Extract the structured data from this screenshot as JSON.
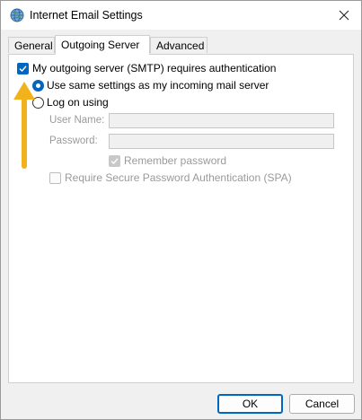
{
  "window": {
    "title": "Internet Email Settings"
  },
  "icons": {
    "app": "globe-icon",
    "close": "close-icon",
    "annotation_arrow": "arrow-up-icon"
  },
  "colors": {
    "accent": "#0067c0",
    "arrow": "#f2b21b"
  },
  "tabs": [
    {
      "label": "General",
      "active": false
    },
    {
      "label": "Outgoing Server",
      "active": true
    },
    {
      "label": "Advanced",
      "active": false
    }
  ],
  "outgoing": {
    "requires_auth_label": "My outgoing server (SMTP) requires authentication",
    "requires_auth_checked": true,
    "use_same_label": "Use same settings as my incoming mail server",
    "use_same_selected": true,
    "log_on_label": "Log on using",
    "log_on_selected": false,
    "username_label": "User Name:",
    "username_value": "",
    "password_label": "Password:",
    "password_value": "",
    "remember_label": "Remember password",
    "remember_checked": true,
    "spa_label": "Require Secure Password Authentication (SPA)",
    "spa_checked": false
  },
  "buttons": {
    "ok": "OK",
    "cancel": "Cancel"
  }
}
